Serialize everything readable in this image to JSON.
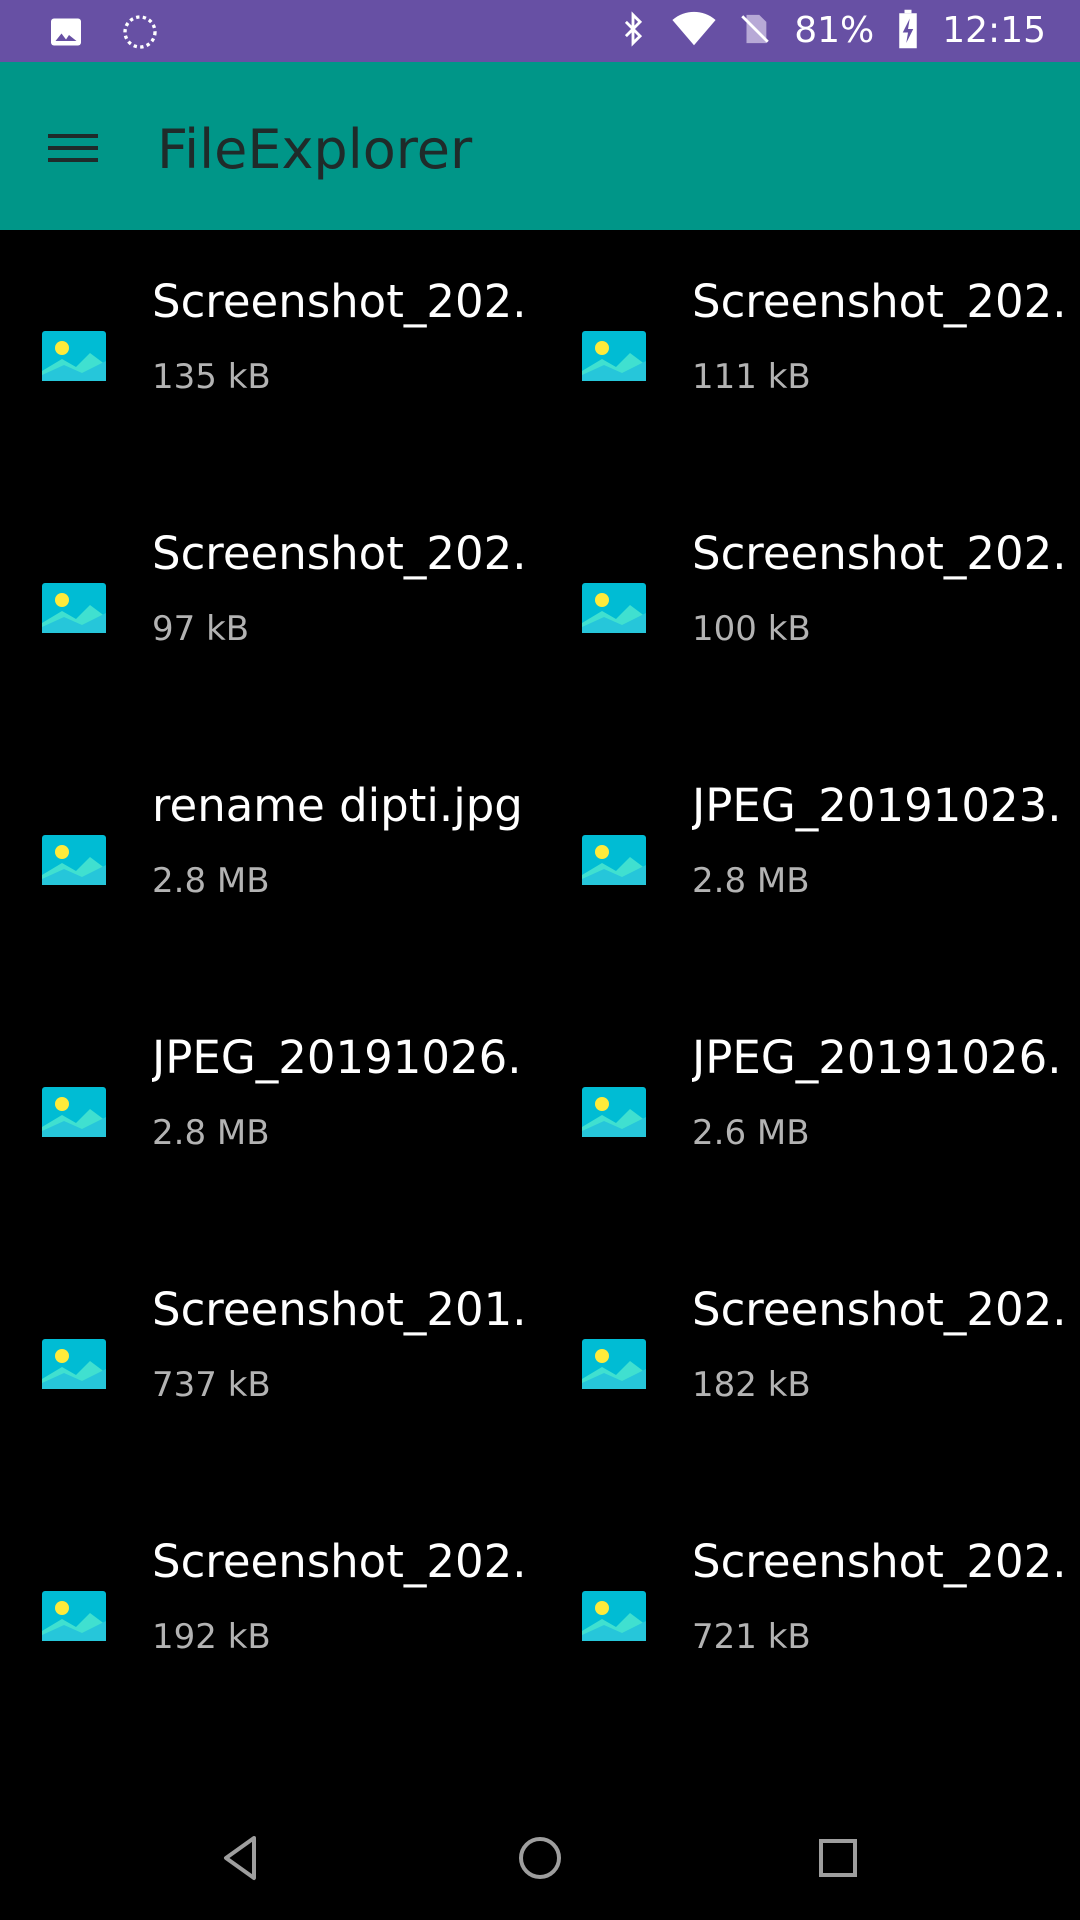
{
  "status_bar": {
    "battery": "81%",
    "time": "12:15",
    "icons": [
      "image-notification-icon",
      "sync-icon",
      "bluetooth-icon",
      "wifi-icon",
      "no-sim-icon",
      "battery-charging-icon"
    ]
  },
  "app_bar": {
    "title": "FileExplorer",
    "menu_icon": "menu-icon",
    "color": "#009688"
  },
  "files": [
    {
      "name": "Screenshot_202..",
      "size": "135 kB"
    },
    {
      "name": "Screenshot_202..",
      "size": "111 kB"
    },
    {
      "name": "Screenshot_202..",
      "size": "97 kB"
    },
    {
      "name": "Screenshot_202..",
      "size": "100 kB"
    },
    {
      "name": "rename dipti.jpg",
      "size": "2.8 MB"
    },
    {
      "name": "JPEG_20191023..",
      "size": "2.8 MB"
    },
    {
      "name": "JPEG_20191026..",
      "size": "2.8 MB"
    },
    {
      "name": "JPEG_20191026..",
      "size": "2.6 MB"
    },
    {
      "name": "Screenshot_201..",
      "size": "737 kB"
    },
    {
      "name": "Screenshot_202..",
      "size": "182 kB"
    },
    {
      "name": "Screenshot_202..",
      "size": "192 kB"
    },
    {
      "name": "Screenshot_202..",
      "size": "721 kB"
    }
  ],
  "nav_bar": {
    "buttons": [
      "back-icon",
      "home-icon",
      "recents-icon"
    ]
  },
  "colors": {
    "status_bar": "#6750a4",
    "app_bar": "#009688",
    "background": "#000000",
    "icon_tile": "#00bcd4"
  }
}
